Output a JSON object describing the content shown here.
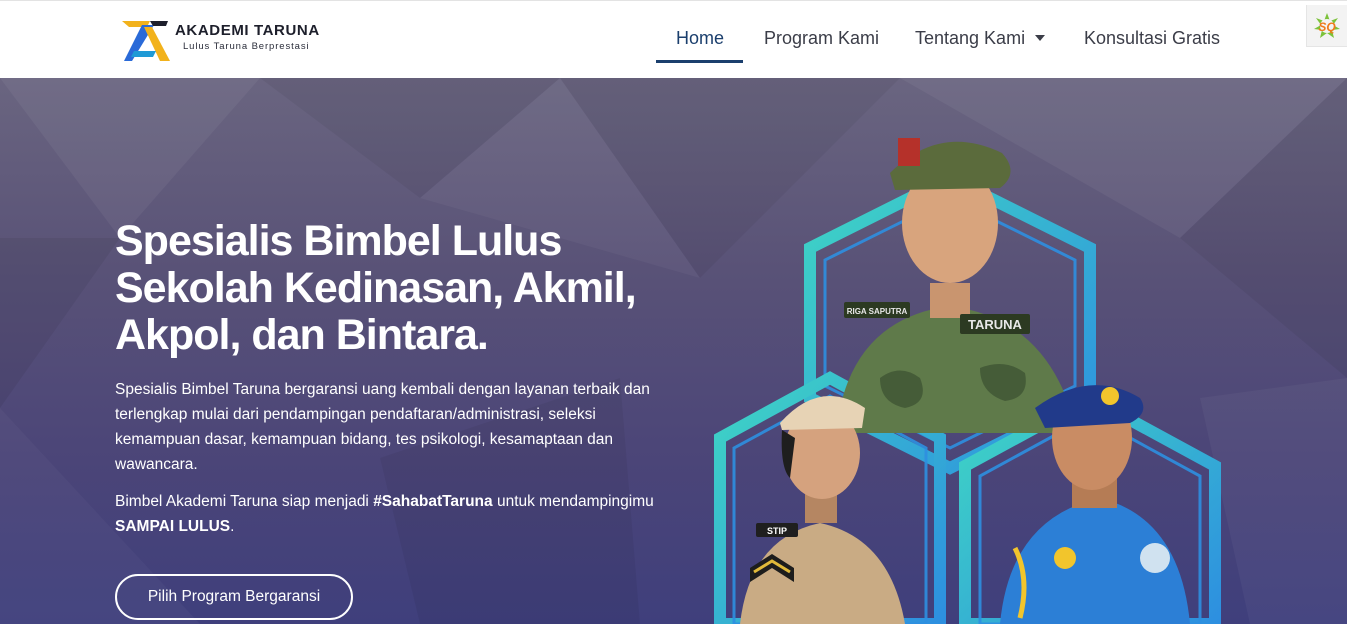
{
  "brand": {
    "name": "AKADEMI TARUNA",
    "tagline": "Lulus Taruna Berprestasi",
    "logo_icon": "akademi-taruna-logo",
    "colors": {
      "yellow": "#f2b21c",
      "blue": "#2a6ad8",
      "dark": "#1d1f2b"
    }
  },
  "nav": {
    "items": [
      {
        "label": "Home",
        "active": true
      },
      {
        "label": "Program Kami",
        "active": false
      },
      {
        "label": "Tentang Kami",
        "active": false,
        "icon": "caret-down-icon"
      },
      {
        "label": "Konsultasi Gratis",
        "active": false
      }
    ],
    "accent": "#1b3f6d"
  },
  "corner_badge": {
    "label": "SQ",
    "icon": "sq-badge-icon"
  },
  "hero": {
    "title": "Spesialis Bimbel Lulus Sekolah Kedinasan, Akmil, Akpol, dan Bintara.",
    "description": "Spesialis Bimbel Taruna bergaransi uang kembali dengan layanan terbaik dan terlengkap mulai dari pendampingan pendaftaran/administrasi, seleksi kemampuan dasar, kemampuan bidang, tes psikologi, kesamaptaan dan wawancara.",
    "sub_prefix": "Bimbel Akademi Taruna siap menjadi ",
    "sub_hashtag": "#SahabatTaruna",
    "sub_middle": " untuk mendampingimu ",
    "sub_emphasis": "SAMPAI LULUS",
    "sub_suffix": ".",
    "cta_label": "Pilih Program Bergaransi",
    "image_labels": {
      "nametag": "RIGA SAPUTRA",
      "uniform_patch": "TARUNA",
      "collar_badge": "STIP"
    },
    "colors": {
      "hex_teal": "#3fd6c4",
      "hex_blue": "#2d8fe0"
    }
  }
}
